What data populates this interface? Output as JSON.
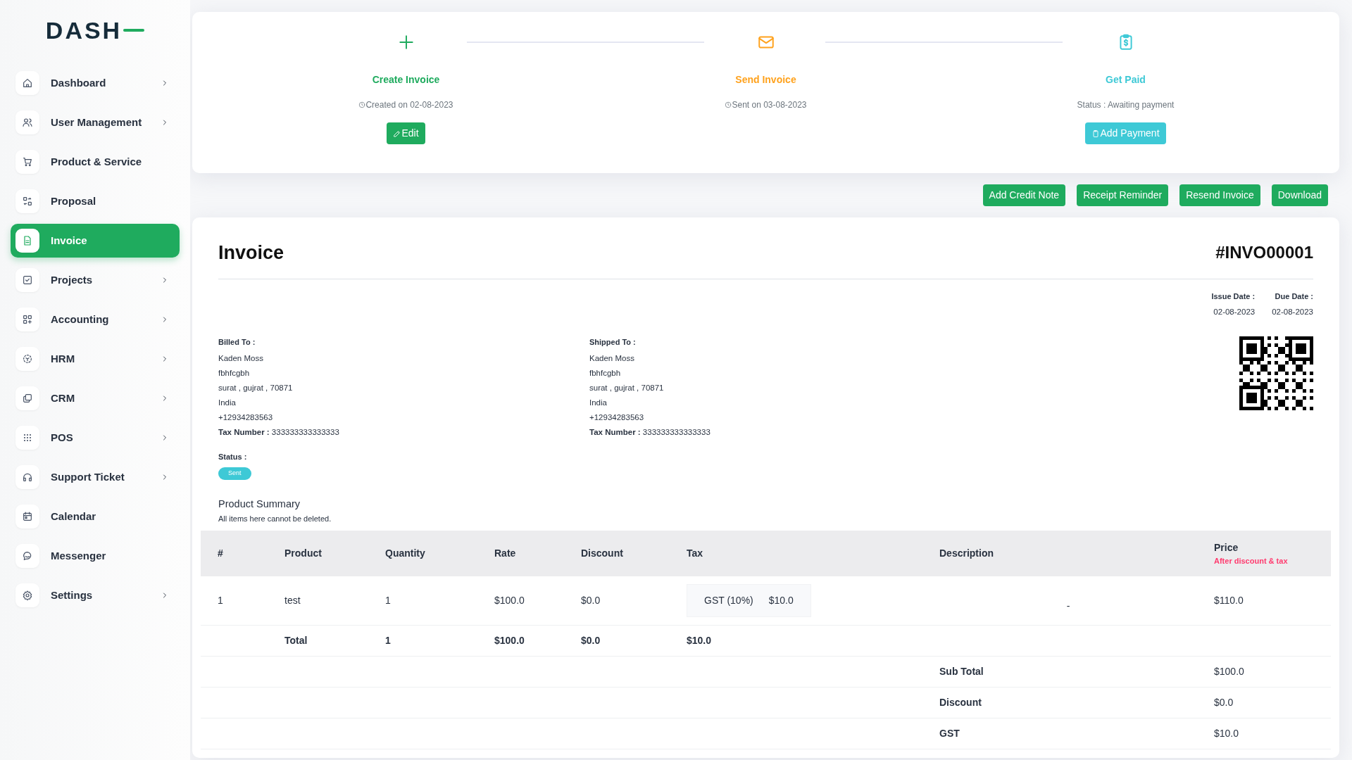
{
  "logo": {
    "text": "DASH"
  },
  "sidebar": {
    "items": [
      {
        "label": "Dashboard",
        "expandable": true,
        "selected": false
      },
      {
        "label": "User Management",
        "expandable": true,
        "selected": false
      },
      {
        "label": "Product & Service",
        "expandable": false,
        "selected": false
      },
      {
        "label": "Proposal",
        "expandable": false,
        "selected": false
      },
      {
        "label": "Invoice",
        "expandable": false,
        "selected": true
      },
      {
        "label": "Projects",
        "expandable": true,
        "selected": false
      },
      {
        "label": "Accounting",
        "expandable": true,
        "selected": false
      },
      {
        "label": "HRM",
        "expandable": true,
        "selected": false
      },
      {
        "label": "CRM",
        "expandable": true,
        "selected": false
      },
      {
        "label": "POS",
        "expandable": true,
        "selected": false
      },
      {
        "label": "Support Ticket",
        "expandable": true,
        "selected": false
      },
      {
        "label": "Calendar",
        "expandable": false,
        "selected": false
      },
      {
        "label": "Messenger",
        "expandable": false,
        "selected": false
      },
      {
        "label": "Settings",
        "expandable": true,
        "selected": false
      }
    ]
  },
  "steps": [
    {
      "kind": "create",
      "title": "Create Invoice",
      "subtitle": "Created on 02-08-2023",
      "button": "Edit",
      "color": "#1fab5e"
    },
    {
      "kind": "send",
      "title": "Send Invoice",
      "subtitle": "Sent on 03-08-2023",
      "color": "#ffa21d"
    },
    {
      "kind": "paid",
      "title": "Get Paid",
      "subtitle": "Status : Awaiting payment",
      "button": "Add Payment",
      "color": "#3ec9d6"
    }
  ],
  "actions": [
    "Add Credit Note",
    "Receipt Reminder",
    "Resend Invoice",
    "Download"
  ],
  "invoice": {
    "title": "Invoice",
    "number": "#INVO00001",
    "dates": [
      {
        "label": "Issue Date :",
        "value": "02-08-2023"
      },
      {
        "label": "Due Date :",
        "value": "02-08-2023"
      }
    ],
    "addresses": [
      {
        "label": "Billed To :",
        "lines": [
          "Kaden Moss",
          "fbhfcgbh",
          "surat , gujrat , 70871",
          "India",
          "+12934283563"
        ],
        "tax": "**Tax Number :** 333333333333333"
      },
      {
        "label": "Shipped To :",
        "lines": [
          "Kaden Moss",
          "fbhfcgbh",
          "surat , gujrat , 70871",
          "India",
          "+12934283563"
        ],
        "tax": "**Tax Number :** 333333333333333"
      }
    ],
    "status_label": "Status :",
    "status": "Sent",
    "summary_title": "Product Summary",
    "summary_note": "All items here cannot be deleted.",
    "table": {
      "columns": [
        "#",
        "Product",
        "Quantity",
        "Rate",
        "Discount",
        "Tax",
        "Description",
        "Price"
      ],
      "price_note": "After discount & tax",
      "rows": [
        {
          "number": "1",
          "product": "test",
          "quantity": "1",
          "rate": "$100.0",
          "discount": "$0.0",
          "tax_name": "GST (10%)",
          "tax_amount": "$10.0",
          "description": "-",
          "price": "$110.0"
        }
      ],
      "total": {
        "label": "Total",
        "quantity": "1",
        "rate": "$100.0",
        "discount": "$0.0",
        "tax": "$10.0"
      },
      "summary": [
        {
          "label": "Sub Total",
          "value": "$100.0"
        },
        {
          "label": "Discount",
          "value": "$0.0"
        },
        {
          "label": "GST",
          "value": "$10.0"
        }
      ]
    }
  }
}
